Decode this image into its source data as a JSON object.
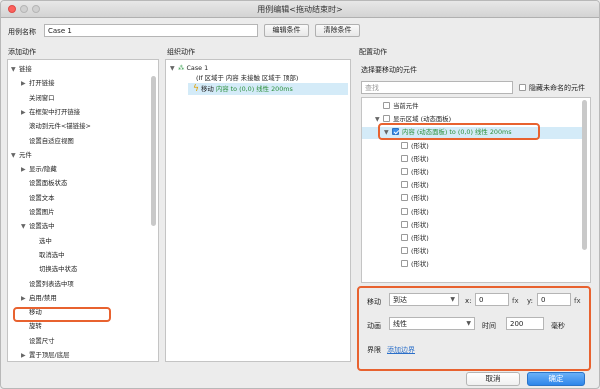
{
  "window": {
    "title": "用例编辑<拖动结束时>"
  },
  "header": {
    "case_name_label": "用例名称",
    "case_name_value": "Case 1",
    "edit_condition": "编辑条件",
    "clear_condition": "清除条件"
  },
  "add_actions": {
    "title": "添加动作",
    "items": [
      {
        "label": "链接",
        "level": 0,
        "arrow": "▼"
      },
      {
        "label": "打开链接",
        "level": 1,
        "arrow": "▶"
      },
      {
        "label": "关闭窗口",
        "level": 1,
        "arrow": ""
      },
      {
        "label": "在框架中打开链接",
        "level": 1,
        "arrow": "▶"
      },
      {
        "label": "滚动到元件<锚链接>",
        "level": 1,
        "arrow": ""
      },
      {
        "label": "设置自适应视图",
        "level": 1,
        "arrow": ""
      },
      {
        "label": "元件",
        "level": 0,
        "arrow": "▼"
      },
      {
        "label": "显示/隐藏",
        "level": 1,
        "arrow": "▶"
      },
      {
        "label": "设置面板状态",
        "level": 1,
        "arrow": ""
      },
      {
        "label": "设置文本",
        "level": 1,
        "arrow": ""
      },
      {
        "label": "设置图片",
        "level": 1,
        "arrow": ""
      },
      {
        "label": "设置选中",
        "level": 1,
        "arrow": "▼"
      },
      {
        "label": "选中",
        "level": 2,
        "arrow": ""
      },
      {
        "label": "取消选中",
        "level": 2,
        "arrow": ""
      },
      {
        "label": "切换选中状态",
        "level": 2,
        "arrow": ""
      },
      {
        "label": "设置列表选中项",
        "level": 1,
        "arrow": ""
      },
      {
        "label": "启用/禁用",
        "level": 1,
        "arrow": "▶"
      },
      {
        "label": "移动",
        "level": 1,
        "arrow": ""
      },
      {
        "label": "旋转",
        "level": 1,
        "arrow": ""
      },
      {
        "label": "设置尺寸",
        "level": 1,
        "arrow": ""
      },
      {
        "label": "置于顶层/底层",
        "level": 1,
        "arrow": "▶"
      }
    ]
  },
  "organize": {
    "title": "组织动作",
    "case_label": "Case 1",
    "condition": "(If 区域于 内容 未接触 区域于 顶部)",
    "action_prefix": "移动 ",
    "action_detail": "内容 to (0,0) 线性 200ms"
  },
  "configure": {
    "title": "配置动作",
    "select_label": "选择要移动的元件",
    "search_placeholder": "查找",
    "hide_unnamed": "隐藏未命名的元件",
    "items": [
      {
        "label": "当前元件",
        "indent": 1,
        "checked": false,
        "arrow": ""
      },
      {
        "label": "显示区域 (动态面板)",
        "indent": 1,
        "checked": false,
        "arrow": "▼"
      },
      {
        "label": "内容 (动态面板) to (0,0) 线性 200ms",
        "indent": 2,
        "checked": true,
        "arrow": "▼"
      },
      {
        "label": "(形状)",
        "indent": 3,
        "checked": false,
        "arrow": ""
      },
      {
        "label": "(形状)",
        "indent": 3,
        "checked": false,
        "arrow": ""
      },
      {
        "label": "(形状)",
        "indent": 3,
        "checked": false,
        "arrow": ""
      },
      {
        "label": "(形状)",
        "indent": 3,
        "checked": false,
        "arrow": ""
      },
      {
        "label": "(形状)",
        "indent": 3,
        "checked": false,
        "arrow": ""
      },
      {
        "label": "(形状)",
        "indent": 3,
        "checked": false,
        "arrow": ""
      },
      {
        "label": "(形状)",
        "indent": 3,
        "checked": false,
        "arrow": ""
      },
      {
        "label": "(形状)",
        "indent": 3,
        "checked": false,
        "arrow": ""
      },
      {
        "label": "(形状)",
        "indent": 3,
        "checked": false,
        "arrow": ""
      },
      {
        "label": "(形状)",
        "indent": 3,
        "checked": false,
        "arrow": ""
      }
    ],
    "move_label": "移动",
    "move_value": "到达",
    "x_label": "x:",
    "x_value": "0",
    "y_label": "y:",
    "y_value": "0",
    "fx": "fx",
    "anim_label": "动画",
    "anim_value": "线性",
    "time_label": "时间",
    "time_value": "200",
    "ms_label": "毫秒",
    "bounds_label": "界限",
    "add_bounds": "添加边界"
  },
  "footer": {
    "cancel": "取消",
    "ok": "确定"
  }
}
